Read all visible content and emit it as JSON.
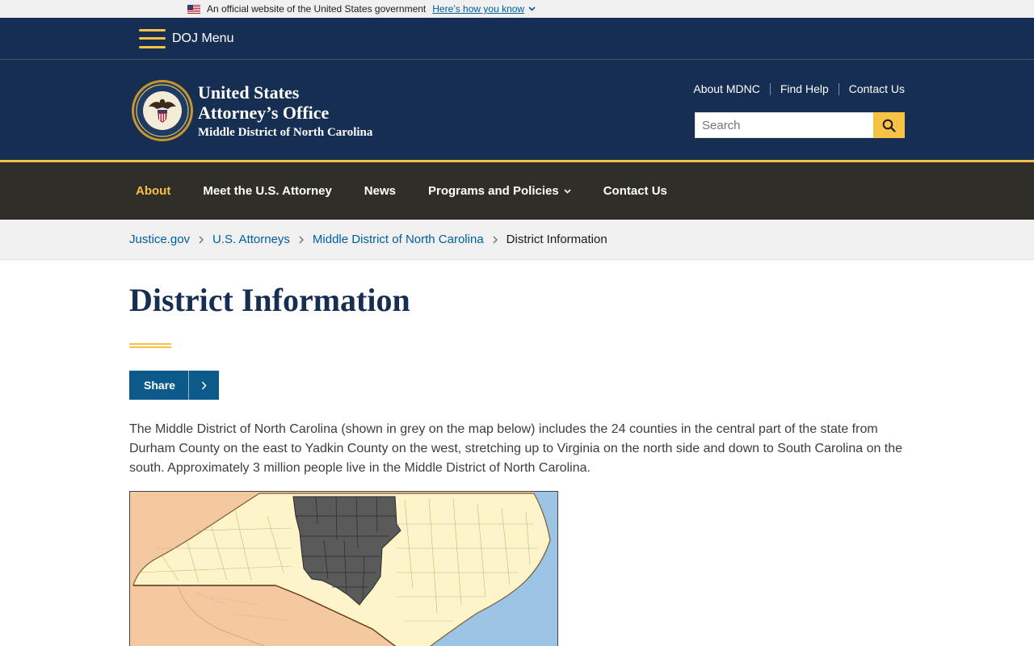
{
  "gov_banner": {
    "text": "An official website of the United States government",
    "link": "Here’s how you know"
  },
  "doj_menu": {
    "label": "DOJ Menu"
  },
  "header": {
    "title_line1": "United States",
    "title_line2": "Attorney’s Office",
    "subtitle": "Middle District of North Carolina",
    "utility_links": [
      "About MDNC",
      "Find Help",
      "Contact Us"
    ],
    "search_placeholder": "Search"
  },
  "main_nav": {
    "items": [
      {
        "label": "About",
        "active": true
      },
      {
        "label": "Meet the U.S. Attorney"
      },
      {
        "label": "News"
      },
      {
        "label": "Programs and Policies",
        "has_dropdown": true
      },
      {
        "label": "Contact Us"
      }
    ]
  },
  "breadcrumb": {
    "items": [
      "Justice.gov",
      "U.S. Attorneys",
      "Middle District of North Carolina"
    ],
    "current": "District Information"
  },
  "page": {
    "title": "District Information",
    "share_label": "Share",
    "intro": "The Middle District of North Carolina (shown in grey on the map below) includes the 24 counties in the central part of the state from Durham County on the east to Yadkin County on the west, stretching up to Virginia on the north side and down to South Carolina on the south. Approximately 3 million people live in the Middle District of North Carolina."
  },
  "colors": {
    "navy": "#162e51",
    "gold": "#f5c245",
    "nav_dark": "#2f2e29",
    "link_blue": "#005ea2",
    "share_blue": "#0b5a8a"
  }
}
